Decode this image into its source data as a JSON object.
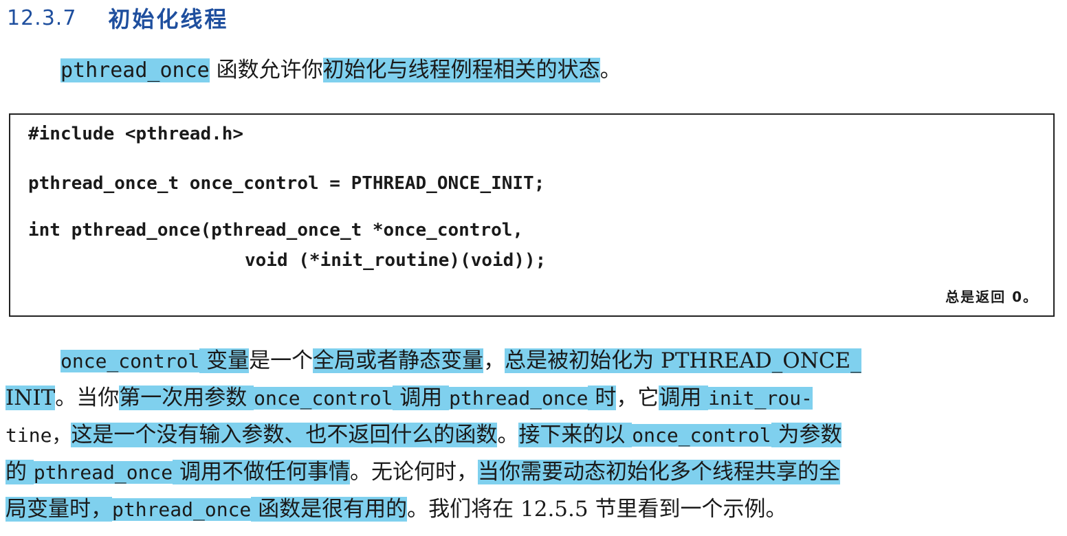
{
  "section": {
    "number": "12.3.7",
    "title": "初始化线程"
  },
  "intro": {
    "func_name": "pthread_once",
    "text_plain": " 函数允许你",
    "text_highlight": "初始化与线程例程相关的状态",
    "text_end": "。"
  },
  "code": {
    "lines": [
      "#include <pthread.h>",
      "pthread_once_t once_control = PTHREAD_ONCE_INIT;",
      "int pthread_once(pthread_once_t *once_control,",
      "void (*init_routine)(void));"
    ],
    "return_note": "总是返回 0。"
  },
  "body": {
    "l1": {
      "a": "once_control",
      "b": " 变量",
      "c": "是一个",
      "d": "全局或者静态变量",
      "e": "，",
      "f": "总是被初始化为 PTHREAD_ONCE_"
    },
    "l2": {
      "a": "INIT",
      "b": "。当你",
      "c": "第一次用参数 ",
      "d": "once_control",
      "e": " 调用 ",
      "f": "pthread_once",
      "g": " 时",
      "h": "，它",
      "i": "调用 ",
      "j": "init_rou-"
    },
    "l3": {
      "a": "tine，",
      "b": "这是一个没有输入参数、也不返回什么的函数",
      "c": "。",
      "d": "接下来的以 ",
      "e": "once_control",
      "f": " 为参数"
    },
    "l4": {
      "a": "的 ",
      "b": "pthread_once",
      "c": " 调用不做任何事情",
      "d": "。无论何时，",
      "e": "当你需要动态初始化多个线程共享的全"
    },
    "l5": {
      "a": "局变量时，",
      "b": "pthread_once",
      "c": " 函数是很有用的",
      "d": "。我们将在 12.5.5 节里看到一个示例。"
    }
  },
  "colors": {
    "highlight": "#7fd0ee",
    "heading": "#1f4f9e",
    "text": "#1a1a1a"
  }
}
